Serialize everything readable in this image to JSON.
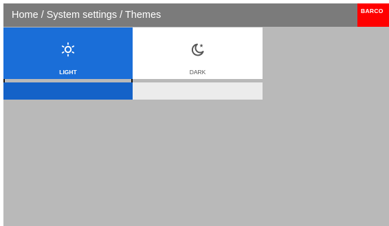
{
  "header": {
    "breadcrumb": "Home / System settings / Themes",
    "logo_text": "BARCO",
    "background": "#7b7b7b",
    "logo_background": "#ff0000"
  },
  "themes": [
    {
      "label": "LIGHT",
      "icon": "sun-icon",
      "selected": true,
      "color": "#1a6ed8"
    },
    {
      "label": "DARK",
      "icon": "moon-icon",
      "selected": false,
      "color": "#ffffff"
    }
  ]
}
